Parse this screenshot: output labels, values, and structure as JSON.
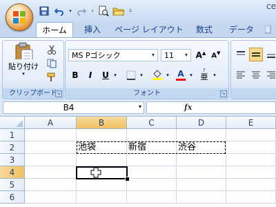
{
  "window": {
    "title_fragment": "ce"
  },
  "ribbon_tabs": [
    {
      "label": "ホーム",
      "active": true
    },
    {
      "label": "挿入"
    },
    {
      "label": "ページ レイアウト"
    },
    {
      "label": "数式"
    },
    {
      "label": "データ"
    }
  ],
  "clipboard": {
    "paste_label": "貼り付け",
    "group_label": "クリップボード"
  },
  "font": {
    "name": "MS Pゴシック",
    "size": "11",
    "group_label": "フォント",
    "bold": "B",
    "italic": "I",
    "underline": "U",
    "phonetic": "亜",
    "font_color_letter": "A"
  },
  "colors": {
    "accent": "#15428b",
    "highlight": "#ffff00",
    "font_color": "#ff0000",
    "selected_header": "#f1c15f"
  },
  "formula_bar": {
    "name_box": "B4",
    "fx": "fx",
    "value": ""
  },
  "columns": [
    "A",
    "B",
    "C",
    "D",
    "E"
  ],
  "rows": [
    "1",
    "2",
    "3",
    "4",
    "5",
    "6"
  ],
  "cells": {
    "B2": "池袋",
    "C2": "新宿",
    "D2": "渋谷"
  },
  "selected_cell": "B4"
}
